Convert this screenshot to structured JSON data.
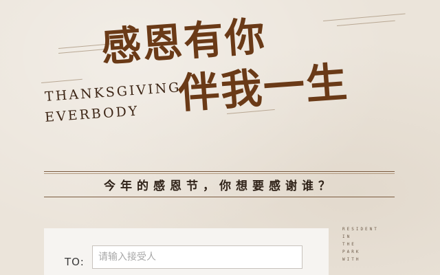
{
  "headline": {
    "line1": "感恩有你",
    "line2": "伴我一生"
  },
  "english_title": {
    "line1": "THANKSGIVING",
    "line2": "EVERBODY"
  },
  "question": "今年的感恩节，你想要感谢谁？",
  "form": {
    "to_label": "TO:",
    "recipient_placeholder": "请输入接受人",
    "recipient_value": ""
  },
  "side_text": [
    "RESIDENT",
    "IN",
    "THE",
    "PARK",
    "WITH"
  ],
  "colors": {
    "background": "#ebe4da",
    "headline": "#6a3a17",
    "english": "#3d2616",
    "rule": "#7a5a3e"
  }
}
